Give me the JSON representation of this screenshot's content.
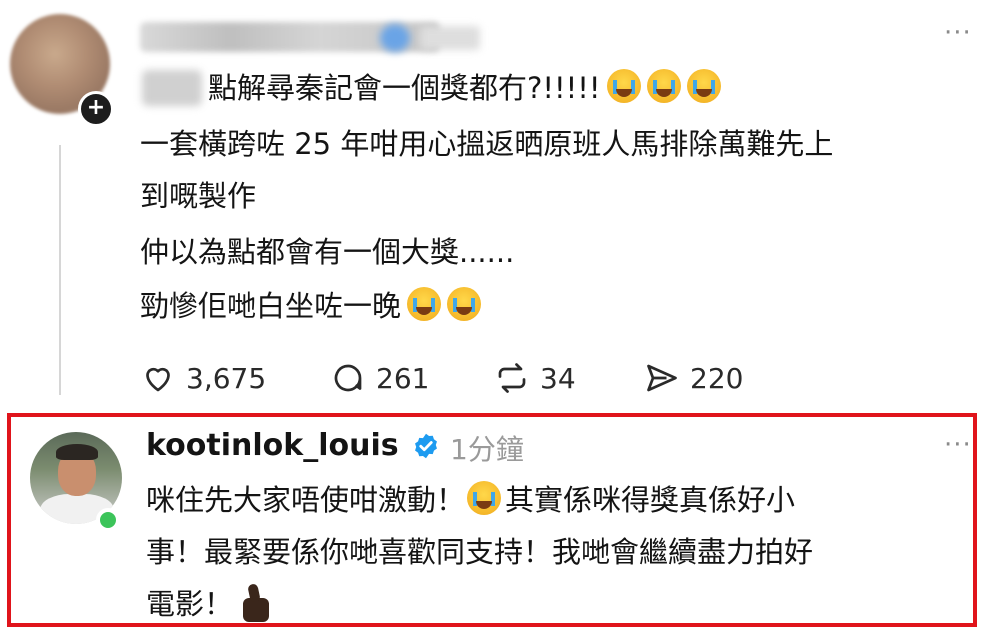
{
  "first_post": {
    "more_label": "···",
    "lines": [
      "點解尋秦記會一個獎都冇?!!!!!",
      "一套橫跨咗 25 年咁用心搵返晒原班人馬排除萬難先上",
      "到嘅製作",
      "仲以為點都會有一個大獎......",
      "勁慘佢哋白坐咗一晚"
    ],
    "stats": {
      "likes": "3,675",
      "comments": "261",
      "reposts": "34",
      "shares": "220"
    }
  },
  "reply": {
    "username": "kootinlok_louis",
    "time": "1分鐘",
    "more_label": "···",
    "lines": [
      "咪住先大家唔使咁激動！",
      "其實係咪得獎真係好小",
      "事！最緊要係你哋喜歡同支持！我哋會繼續盡力拍好",
      "電影！"
    ]
  },
  "colors": {
    "highlight_border": "#e0141b",
    "verified": "#1d9bf0",
    "online": "#3cc45a"
  },
  "icons": [
    "plus-icon",
    "heart-icon",
    "comment-icon",
    "repost-icon",
    "share-icon",
    "verified-icon",
    "crying-emoji",
    "laughing-emoji",
    "thumbs-up-emoji"
  ]
}
